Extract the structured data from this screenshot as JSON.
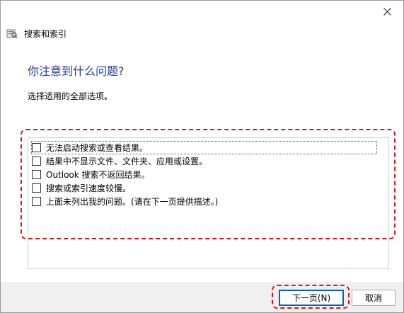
{
  "window": {
    "title": "搜索和索引"
  },
  "page": {
    "heading": "你注意到什么问题?",
    "instruction": "选择适用的全部选项。"
  },
  "options": [
    {
      "label": "无法启动搜索或查看结果。",
      "checked": false
    },
    {
      "label": "结果中不显示文件、文件夹、应用或设置。",
      "checked": false
    },
    {
      "label": "Outlook 搜索不返回结果。",
      "checked": false
    },
    {
      "label": "搜索或索引速度较慢。",
      "checked": false
    },
    {
      "label": "上面未列出我的问题。(请在下一页提供描述。)",
      "checked": false
    }
  ],
  "footer": {
    "next_label": "下一页(N)",
    "cancel_label": "取消"
  },
  "colors": {
    "heading": "#1e3a9c",
    "highlight": "#d6161c",
    "accent": "#0067c0"
  }
}
